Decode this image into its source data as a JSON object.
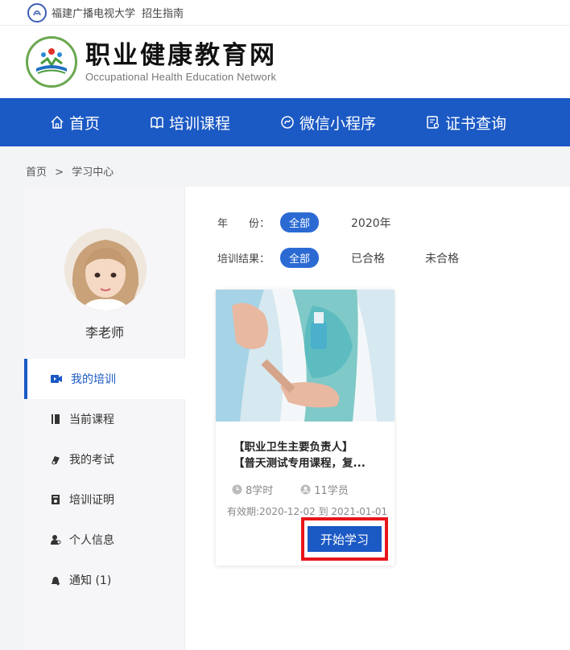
{
  "topbar": {
    "university": "福建广播电视大学",
    "guide": "招生指南"
  },
  "header": {
    "title": "职业健康教育网",
    "subtitle": "Occupational Health Education Network"
  },
  "nav": [
    {
      "label": "首页",
      "icon": "home-icon"
    },
    {
      "label": "培训课程",
      "icon": "book-icon"
    },
    {
      "label": "微信小程序",
      "icon": "mini-program-icon"
    },
    {
      "label": "证书查询",
      "icon": "certificate-icon"
    }
  ],
  "breadcrumb": {
    "home": "首页",
    "sep": ">",
    "current": "学习中心"
  },
  "user": {
    "name": "李老师"
  },
  "menu": [
    {
      "label": "我的培训",
      "icon": "video-icon",
      "active": true
    },
    {
      "label": "当前课程",
      "icon": "book-icon",
      "active": false
    },
    {
      "label": "我的考试",
      "icon": "exam-icon",
      "active": false
    },
    {
      "label": "培训证明",
      "icon": "certificate-icon",
      "active": false
    },
    {
      "label": "个人信息",
      "icon": "user-icon",
      "active": false
    },
    {
      "label": "通知 (1)",
      "icon": "bell-icon",
      "active": false
    }
  ],
  "filters": {
    "year": {
      "label": "年　　份：",
      "selected": "全部",
      "options": [
        "2020年"
      ]
    },
    "result": {
      "label": "培训结果：",
      "selected": "全部",
      "options": [
        "已合格",
        "未合格"
      ]
    }
  },
  "course": {
    "title_line1": "【职业卫生主要负责人】",
    "title_line2": "【普天测试专用课程，复...",
    "hours": "8学时",
    "students": "11学员",
    "validity": "有效期:2020-12-02 到 2021-01-01",
    "button": "开始学习"
  },
  "colors": {
    "primary": "#1b59c4",
    "highlight": "#e8161b"
  }
}
